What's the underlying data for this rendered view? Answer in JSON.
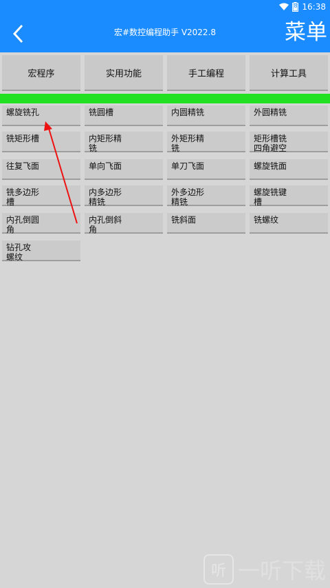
{
  "status_bar": {
    "time": "16:38",
    "battery_level": "8"
  },
  "app_bar": {
    "title": "宏#数控编程助手 V2022.8",
    "menu_label": "菜单"
  },
  "tabs": [
    "宏程序",
    "实用功能",
    "手工编程",
    "计算工具"
  ],
  "colors": {
    "accent": "#1a8cff",
    "progress": "#22e022",
    "arrow": "#ee1111"
  },
  "items": [
    "螺旋铣孔",
    "铣圆槽",
    "内圆精铣",
    "外圆精铣",
    "铣矩形槽",
    "内矩形精\n铣",
    "外矩形精\n铣",
    "矩形槽铣\n四角避空",
    "往复飞面",
    "单向飞面",
    "单刀飞面",
    "螺旋铣面",
    "铣多边形\n槽",
    "内多边形\n精铣",
    "外多边形\n精铣",
    "螺旋铣键\n槽",
    "内孔倒圆\n角",
    "内孔倒斜\n角",
    "铣斜面",
    "铣螺纹",
    "钻孔攻\n螺纹"
  ],
  "watermark": {
    "logo_glyph": "听",
    "text": "一听下载"
  }
}
